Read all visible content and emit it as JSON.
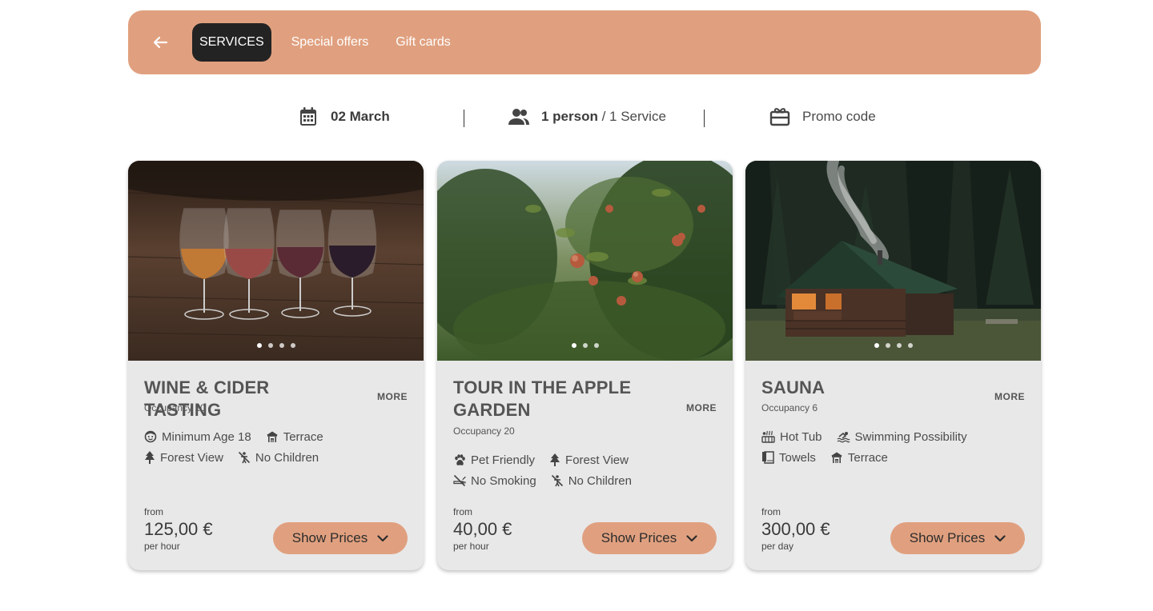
{
  "nav": {
    "tabs": [
      {
        "label": "SERVICES",
        "active": true
      },
      {
        "label": "Special offers",
        "active": false
      },
      {
        "label": "Gift cards",
        "active": false
      }
    ]
  },
  "filters": {
    "date": "02 March",
    "persons": "1 person",
    "divider": " / ",
    "services": "1 Service",
    "promo": "Promo code"
  },
  "colors": {
    "accent": "#e0a07f",
    "active_tab": "#232323",
    "card_bg": "#e8e8e8"
  },
  "cards": [
    {
      "title": "WINE & CIDER TASTING",
      "more": "MORE",
      "occupancy": "Occupancy 10",
      "amenities": [
        "Minimum Age 18",
        "Terrace",
        "Forest View",
        "No Children"
      ],
      "from": "from",
      "price": "125,00 €",
      "per": "per hour",
      "button": "Show Prices",
      "image": "wine-glasses-photo",
      "slides": 4,
      "active_slide": 1
    },
    {
      "title": "TOUR IN THE APPLE GARDEN",
      "more": "MORE",
      "occupancy": "Occupancy 20",
      "amenities": [
        "Pet Friendly",
        "Forest View",
        "No Smoking",
        "No Children"
      ],
      "from": "from",
      "price": "40,00 €",
      "per": "per hour",
      "button": "Show Prices",
      "image": "apple-tree-photo",
      "slides": 3,
      "active_slide": 1
    },
    {
      "title": "SAUNA",
      "more": "MORE",
      "occupancy": "Occupancy 6",
      "amenities": [
        "Hot Tub",
        "Swimming Possibility",
        "Towels",
        "Terrace"
      ],
      "from": "from",
      "price": "300,00 €",
      "per": "per day",
      "button": "Show Prices",
      "image": "forest-cabin-photo",
      "slides": 4,
      "active_slide": 1
    }
  ]
}
